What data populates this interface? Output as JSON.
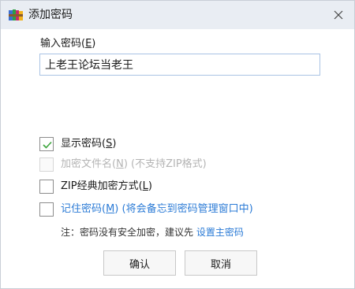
{
  "window": {
    "title": "添加密码",
    "app_icon": "winrar-archive-icon",
    "close_icon": "close-icon"
  },
  "password": {
    "label_prefix": "输入密码(",
    "label_key": "E",
    "label_suffix": ")",
    "value": "上老王论坛当老王"
  },
  "options": {
    "show_password": {
      "label": "显示密码(",
      "key": "S",
      "suffix": ")",
      "checked": true
    },
    "encrypt_filenames": {
      "label": "加密文件名(",
      "key": "N",
      "suffix": ") (不支持ZIP格式)",
      "checked": false,
      "disabled": true
    },
    "zip_legacy": {
      "label": "ZIP经典加密方式(",
      "key": "L",
      "suffix": ")",
      "checked": false
    },
    "remember": {
      "label": "记住密码(",
      "key": "M",
      "suffix": ") (将会备忘到密码管理窗口中)",
      "checked": false
    }
  },
  "note": {
    "text": "注：密码没有安全加密，建议先 ",
    "link": "设置主密码"
  },
  "buttons": {
    "ok": "确认",
    "cancel": "取消"
  },
  "colors": {
    "accent": "#2b7bd6",
    "titlebar": "#e9edf3",
    "check": "#3ca53c"
  }
}
